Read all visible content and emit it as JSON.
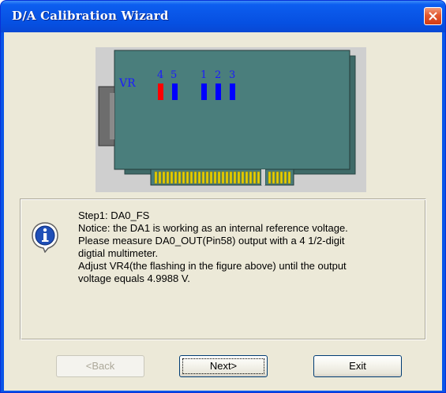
{
  "window": {
    "title": "D/A Calibration Wizard"
  },
  "figure": {
    "vr_label": "VR",
    "vr_numbers": [
      "4",
      "5",
      "1",
      "2",
      "3"
    ],
    "flashing_vr": "4",
    "colors": {
      "board": "#4a7e7c",
      "vr_active": "#ff0000",
      "vr_normal": "#0000ff",
      "gold_contacts": "#e8d000"
    }
  },
  "message": {
    "line1": "Step1: DA0_FS",
    "line2": "Notice: the DA1 is working as an internal reference voltage.",
    "line3": "Please measure DA0_OUT(Pin58) output with a 4 1/2-digit",
    "line4": "digtial multimeter.",
    "line5": "Adjust VR4(the flashing in the figure above) until the output",
    "line6": "voltage equals 4.9988 V.",
    "icon": "info-icon"
  },
  "buttons": {
    "back": "<Back",
    "next": "Next>",
    "exit": "Exit"
  },
  "colors": {
    "titlebar": "#0a57e8",
    "dialog_face": "#ece9d8",
    "close_button": "#e2582f"
  }
}
